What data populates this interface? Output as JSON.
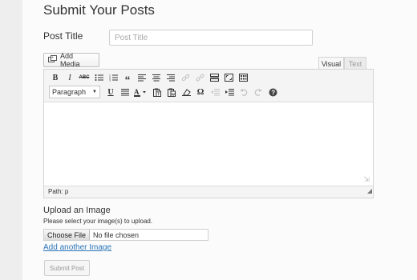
{
  "page": {
    "title": "Submit Your Posts"
  },
  "post_title": {
    "label": "Post Title",
    "placeholder": "Post Title",
    "value": ""
  },
  "editor": {
    "add_media_label": "Add Media",
    "tabs": {
      "visual": "Visual",
      "text": "Text",
      "active": "visual"
    },
    "toolbar_row1": [
      {
        "name": "bold-icon",
        "glyph": "B"
      },
      {
        "name": "italic-icon",
        "glyph": "I"
      },
      {
        "name": "strikethrough-icon",
        "glyph": "ABC"
      },
      {
        "name": "bullet-list-icon"
      },
      {
        "name": "numbered-list-icon"
      },
      {
        "name": "blockquote-icon",
        "glyph": "“"
      },
      {
        "name": "align-left-icon"
      },
      {
        "name": "align-center-icon"
      },
      {
        "name": "align-right-icon"
      },
      {
        "name": "insert-link-icon",
        "disabled": true
      },
      {
        "name": "remove-link-icon",
        "disabled": true
      },
      {
        "name": "read-more-icon"
      },
      {
        "name": "fullscreen-icon"
      },
      {
        "name": "toolbar-toggle-icon"
      }
    ],
    "format_select_value": "Paragraph",
    "toolbar_row2": [
      {
        "name": "underline-icon",
        "glyph": "U"
      },
      {
        "name": "justify-icon"
      },
      {
        "name": "text-color-icon",
        "glyph": "A"
      },
      {
        "name": "paste-text-icon"
      },
      {
        "name": "paste-word-icon"
      },
      {
        "name": "clear-formatting-icon"
      },
      {
        "name": "special-character-icon",
        "glyph": "Ω"
      },
      {
        "name": "outdent-icon",
        "disabled": true
      },
      {
        "name": "indent-icon"
      },
      {
        "name": "undo-icon",
        "disabled": true
      },
      {
        "name": "redo-icon",
        "disabled": true
      },
      {
        "name": "help-icon",
        "glyph": "?"
      }
    ],
    "status_path": "Path: p"
  },
  "upload": {
    "heading": "Upload an Image",
    "help": "Please select your image(s) to upload.",
    "choose_file_label": "Choose File",
    "file_status": "No file chosen",
    "add_another_label": "Add another Image"
  },
  "submit": {
    "label": "Submit Post"
  },
  "colors": {
    "link": "#2a74b8",
    "background": "#fbfbfb",
    "gutter": "#eeeeee"
  }
}
